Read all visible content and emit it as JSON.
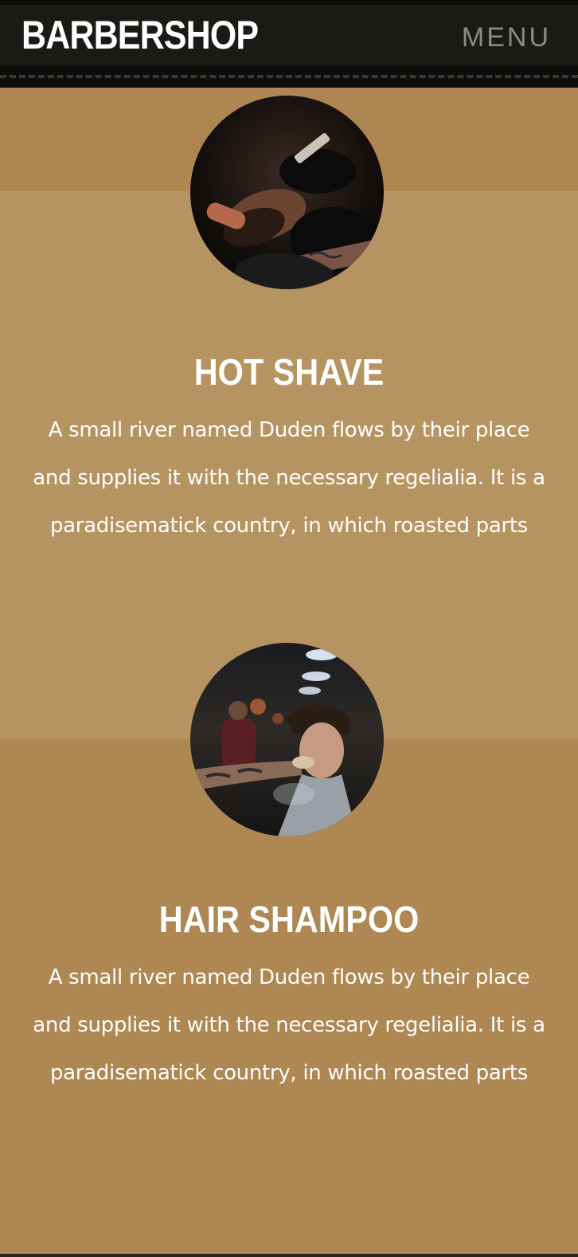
{
  "header": {
    "brand": "BARBERSHOP",
    "menu_label": "MENU"
  },
  "services": [
    {
      "title": "HOT SHAVE",
      "description": "A small river named Duden flows by their place and supplies it with the necessary regelialia. It is a paradisematick country, in which roasted parts",
      "photo": "hot-shave-photo"
    },
    {
      "title": "HAIR SHAMPOO",
      "description": "A small river named Duden flows by their place and supplies it with the necessary regelialia. It is a paradisematick country, in which roasted parts",
      "photo": "hair-shampoo-photo"
    }
  ],
  "colors": {
    "header_bg": "#1b1a17",
    "section_light": "#b69462",
    "section_dark": "#ae8752",
    "text": "#ffffff",
    "menu": "#8d8b87"
  }
}
